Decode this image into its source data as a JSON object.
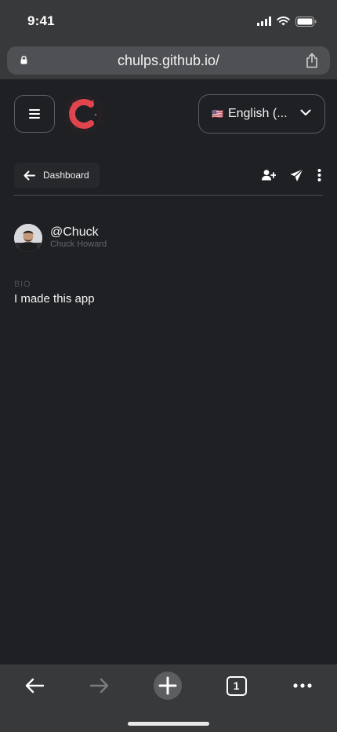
{
  "status_bar": {
    "time": "9:41"
  },
  "browser": {
    "url": "chulps.github.io/",
    "tab_count": "1"
  },
  "header": {
    "language": "English (...",
    "flag": "🇺🇸"
  },
  "toolbar": {
    "back_label": "Dashboard"
  },
  "profile": {
    "handle": "@Chuck",
    "name": "Chuck Howard",
    "bio_label": "BIO",
    "bio": "I made this app"
  },
  "colors": {
    "background": "#1f2024",
    "browser_chrome": "#38393b",
    "logo_accent": "#e0454d"
  }
}
